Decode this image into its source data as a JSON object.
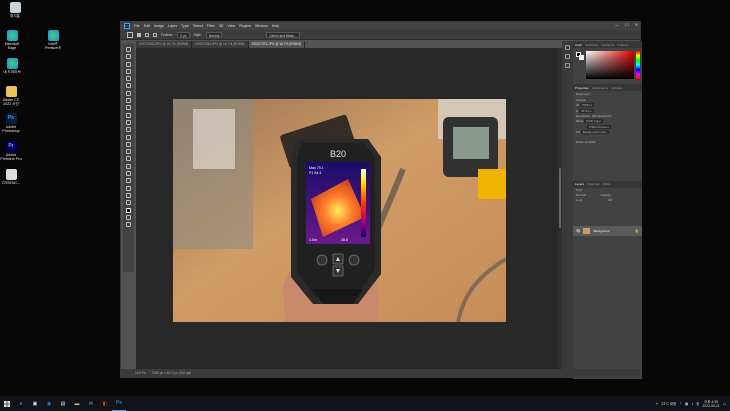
{
  "desktop": {
    "icons": [
      {
        "label": "휴지통",
        "color": "#c9d1d9"
      },
      {
        "label": "Microsoft Edge",
        "color": "#1e8fe0"
      },
      {
        "label": "Intel® Pentium®",
        "color": "#1e8fe0"
      },
      {
        "label": "내 드라이브",
        "color": "#1e8fe0"
      },
      {
        "label": "Adobe CC 2022 사진",
        "color": "#e8c25a"
      },
      {
        "label": "Adobe Photoshop",
        "color": "#31a8ff"
      },
      {
        "label": "Adobe Premiere Pro",
        "color": "#9999ff"
      },
      {
        "label": "CRSENC...",
        "color": "#dddddd"
      }
    ]
  },
  "photoshop": {
    "menu": [
      "File",
      "Edit",
      "Image",
      "Layer",
      "Type",
      "Select",
      "Filter",
      "3D",
      "View",
      "Plugins",
      "Window",
      "Help"
    ],
    "window_controls": [
      "—",
      "☐",
      "✕"
    ],
    "options_bar": {
      "feather_label": "Feather:",
      "feather_value": "0 px",
      "style_label": "Style:",
      "style_value": "Normal",
      "select_mask": "Select and Mask..."
    },
    "tabs": [
      {
        "label": "DSC07343.JPG @ 16.7% (RGB/8)",
        "active": false
      },
      {
        "label": "DSC07344.JPG @ 16.7% (RGB/8)",
        "active": false
      },
      {
        "label": "DSC07373.JPG @ 16.7% (RGB/8)",
        "active": true
      }
    ],
    "status": {
      "zoom": "16.67%",
      "doc": "7008 px x 4672 px (300 ppi)"
    },
    "device": {
      "brand": "B20",
      "max": "Max 75.1",
      "p1": "P1 64.4",
      "low": "1.0m",
      "emiss": "28.6"
    },
    "panels": {
      "color_tabs": [
        "Color",
        "Swatches",
        "Gradients",
        "Patterns"
      ],
      "props_tabs": [
        "Properties",
        "Adjustments",
        "Libraries"
      ],
      "props_doc": "Document",
      "canvas_label": "Canvas",
      "w_label": "W",
      "w_value": "7008 px",
      "h_label": "H",
      "h_value": "4672 px",
      "res_label": "Resolution:",
      "res_value": "300 pixels/inch",
      "mode_label": "Mode",
      "mode_value": "RGB Color",
      "bits_value": "8 Bits/Channel",
      "fill_label": "Fill",
      "fill_value": "Background Color",
      "rulers_label": "Rulers & Grids",
      "layers_tabs": [
        "Layers",
        "Channels",
        "Paths"
      ],
      "kind_label": "Kind",
      "mode_normal": "Normal",
      "opacity_label": "Opacity:",
      "lock_label": "Lock:",
      "fill2_label": "Fill:",
      "layer_name": "Background"
    }
  },
  "taskbar": {
    "search_icon": "search-icon",
    "weather": "23°C 맑음",
    "time": "오후 4:30",
    "date": "2022-05-21",
    "lang": "한"
  }
}
